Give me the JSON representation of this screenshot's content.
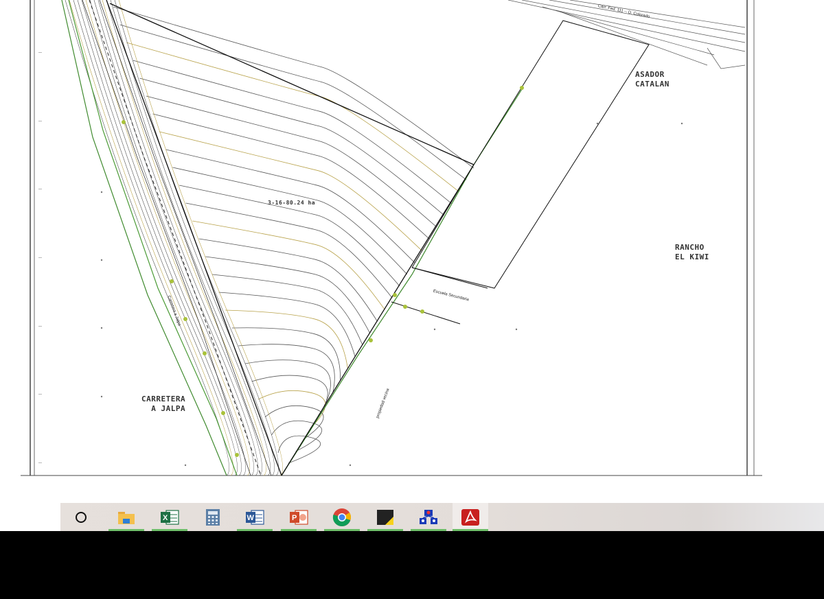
{
  "map": {
    "parcel_area": "3-16-80.24 ha",
    "labels": {
      "asador": "ASADOR\nCATALAN",
      "rancho": "RANCHO\nEL KIWI",
      "carretera": "CARRETERA\n  A JALPA",
      "escuela": "Escuela Secundaria",
      "predio": "propiedad vecina",
      "road_top": "Carr. Fed. 111 -- D. Colorado",
      "road_left": "Carretera a Jalpa"
    },
    "colors": {
      "contour_dark": "#555555",
      "contour_tan": "#b8a24a",
      "green_line": "#3f8a2e",
      "boundary": "#111111"
    }
  },
  "taskbar": {
    "apps": [
      {
        "name": "cortana-search-icon",
        "active": false
      },
      {
        "name": "file-explorer-icon",
        "active": true
      },
      {
        "name": "excel-icon",
        "active": true
      },
      {
        "name": "calculator-icon",
        "active": false
      },
      {
        "name": "word-icon",
        "active": true
      },
      {
        "name": "powerpoint-icon",
        "active": true
      },
      {
        "name": "chrome-icon",
        "active": true
      },
      {
        "name": "sticky-notes-icon",
        "active": true
      },
      {
        "name": "network-app-icon",
        "active": true
      },
      {
        "name": "acrobat-reader-icon",
        "active": true
      }
    ]
  }
}
